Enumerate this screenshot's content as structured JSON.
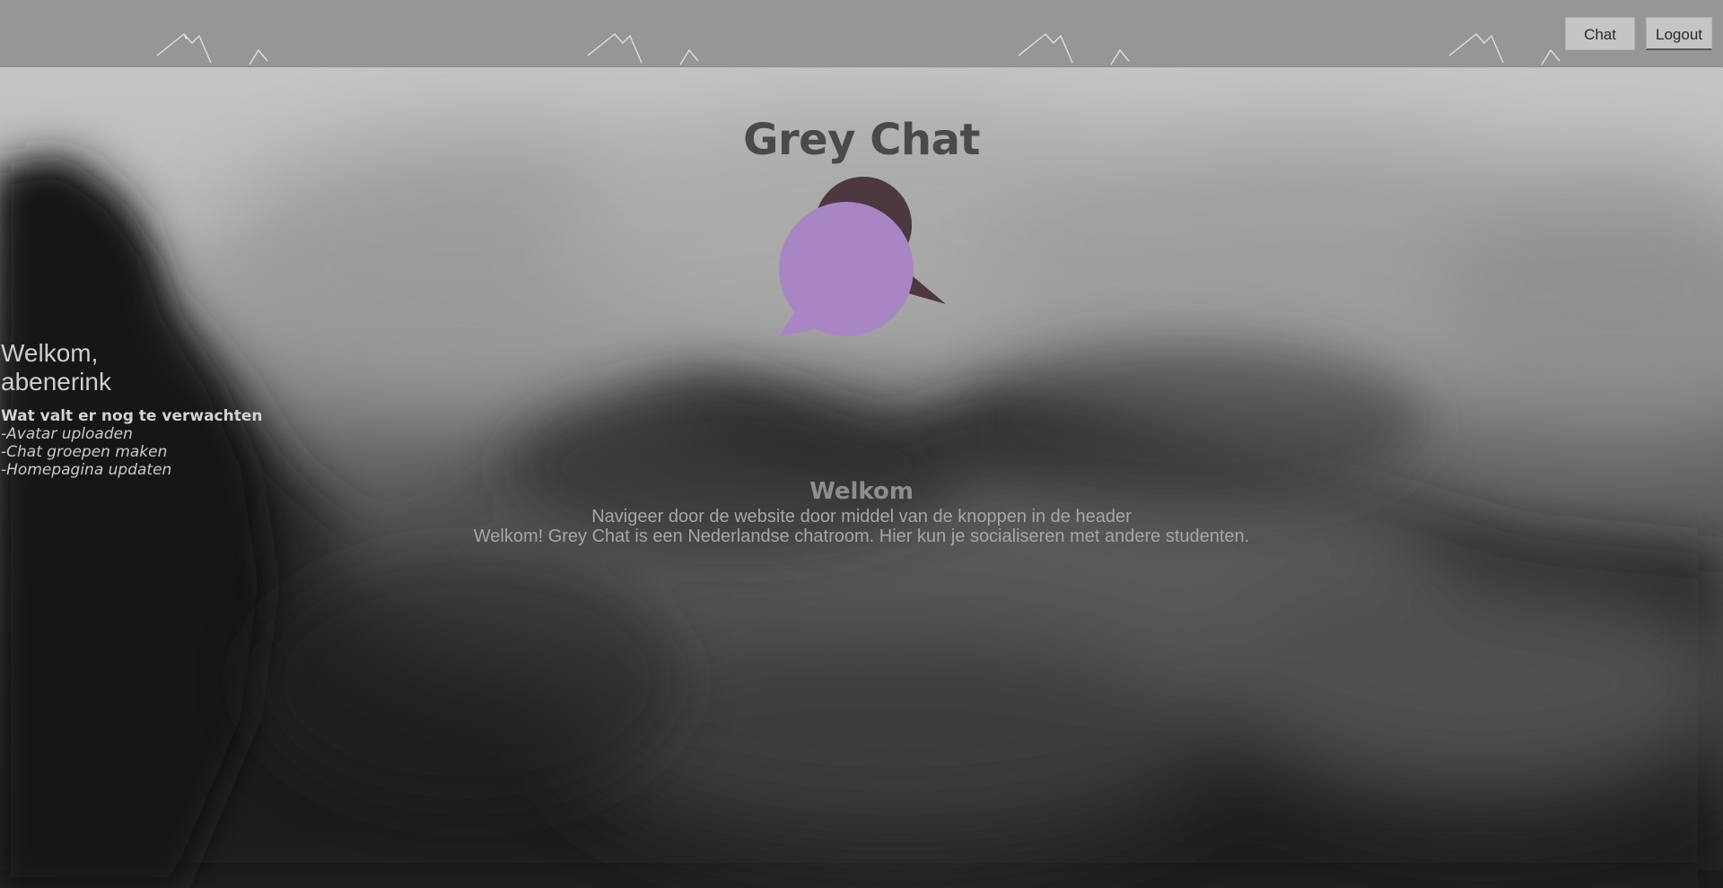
{
  "header": {
    "nav": [
      {
        "label": "Chat"
      },
      {
        "label": "Logout"
      }
    ]
  },
  "brand": {
    "title": "Grey Chat",
    "logo_icon": "speech-bubbles-icon",
    "colors": {
      "front_bubble": "#a886c4",
      "back_bubble": "#4d3740"
    }
  },
  "side": {
    "greeting_line1": "Welkom,",
    "greeting_line2": "abenerink",
    "heading": "Wat valt er nog te verwachten",
    "items": [
      "-Avatar uploaden",
      "-Chat groepen maken",
      "-Homepagina updaten"
    ]
  },
  "main": {
    "title": "Welkom",
    "line1": "Navigeer door de website door middel van de knoppen in de header",
    "line2": "Welkom! Grey Chat is een Nederlandse chatroom. Hier kun je socialiseren met andere studenten."
  },
  "colors": {
    "header_bg": "#969696",
    "button_bg": "#c5c5c5",
    "title_text": "#4a4a4a"
  }
}
